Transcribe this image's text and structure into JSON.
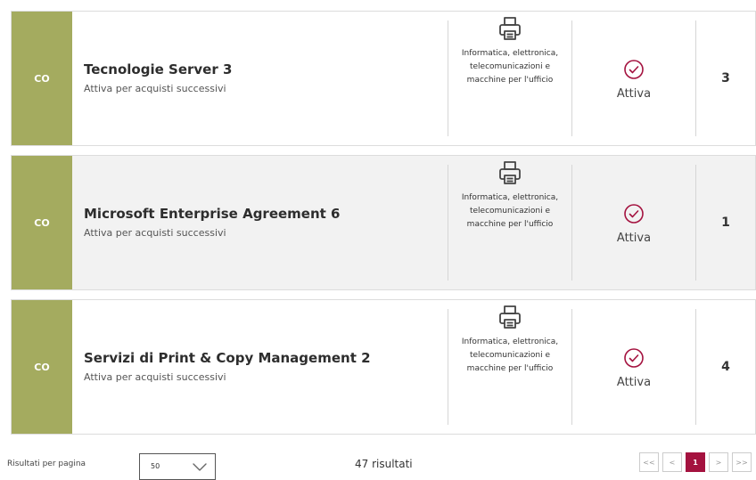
{
  "colors": {
    "code_bg": "#a4ab5f",
    "accent": "#a4123f",
    "row_alt_bg": "#f2f2f2"
  },
  "items": [
    {
      "code": "CO",
      "title": "Tecnologie Server 3",
      "subtitle": "Attiva per acquisti successivi",
      "category": "Informatica, elettronica, telecomunicazioni e macchine per l'ufficio",
      "category_icon": "printer-icon",
      "status": "Attiva",
      "status_icon": "check-circle-icon",
      "count": "3"
    },
    {
      "code": "CO",
      "title": "Microsoft Enterprise Agreement 6",
      "subtitle": "Attiva per acquisti successivi",
      "category": "Informatica, elettronica, telecomunicazioni e macchine per l'ufficio",
      "category_icon": "printer-icon",
      "status": "Attiva",
      "status_icon": "check-circle-icon",
      "count": "1"
    },
    {
      "code": "CO",
      "title": "Servizi di Print & Copy Management 2",
      "subtitle": "Attiva per acquisti successivi",
      "category": "Informatica, elettronica, telecomunicazioni e macchine per l'ufficio",
      "category_icon": "printer-icon",
      "status": "Attiva",
      "status_icon": "check-circle-icon",
      "count": "4"
    }
  ],
  "footer": {
    "per_page_label": "Risultati per pagina",
    "per_page_value": "50",
    "results": "47 risultati",
    "pagination": {
      "first": "<<",
      "prev": "<",
      "current": "1",
      "next": ">",
      "last": ">>"
    }
  }
}
